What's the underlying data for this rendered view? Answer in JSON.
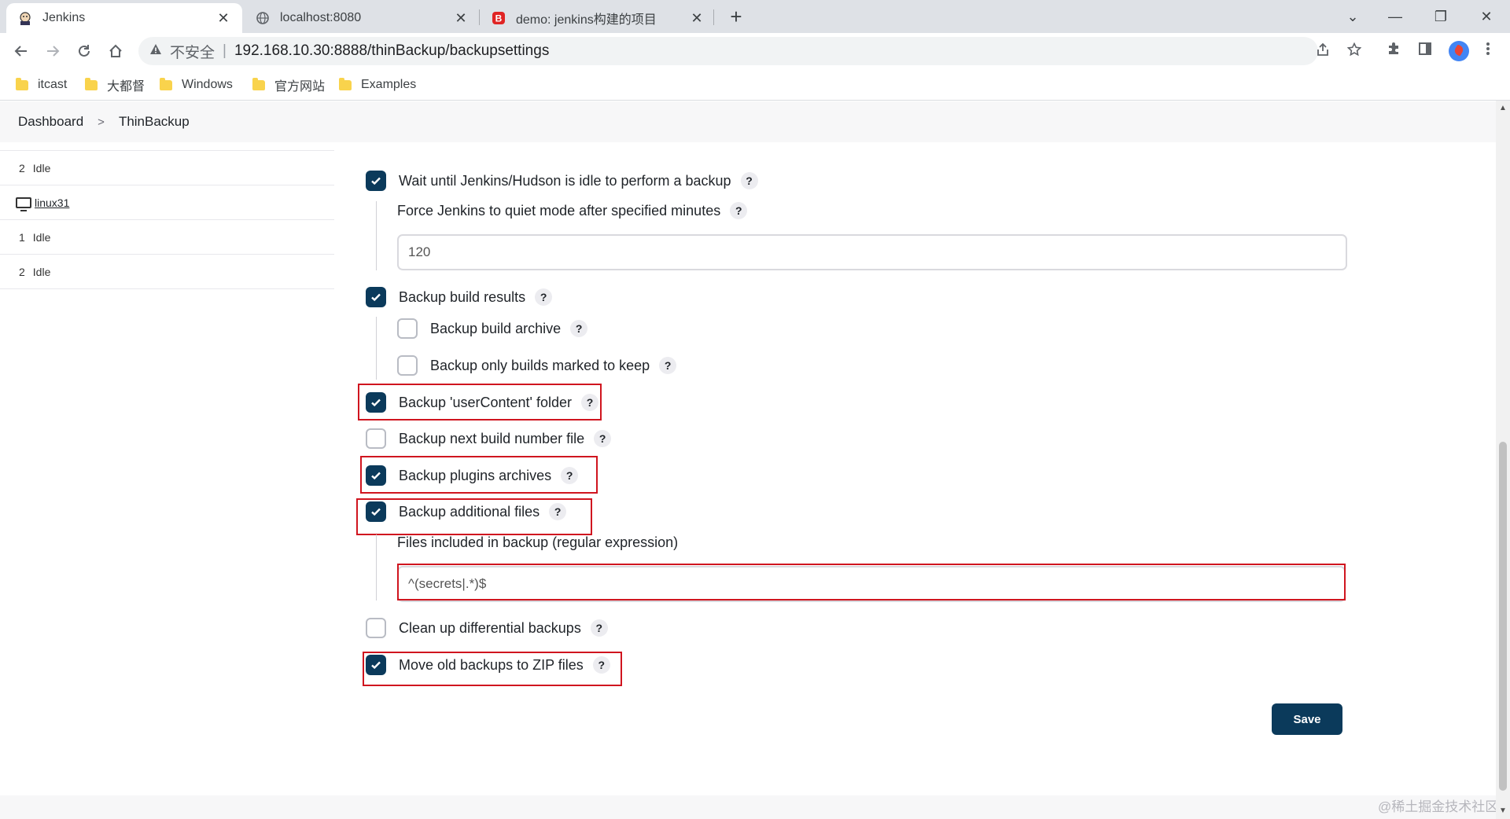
{
  "browser": {
    "tabs": [
      {
        "title": "Jenkins",
        "active": true
      },
      {
        "title": "localhost:8080",
        "active": false
      },
      {
        "title": "demo: jenkins构建的项目",
        "active": false
      }
    ],
    "close_glyph": "✕",
    "new_tab_glyph": "+",
    "window_controls": {
      "chevron": "⌄",
      "minimize": "—",
      "restore": "❐",
      "close": "✕"
    },
    "address": {
      "insecure_label": "不安全",
      "separator": "|",
      "url": "192.168.10.30:8888/thinBackup/backupsettings"
    },
    "bookmarks": [
      "itcast",
      "大都督",
      "Windows",
      "官方网站",
      "Examples"
    ]
  },
  "breadcrumb": {
    "items": [
      "Dashboard",
      "ThinBackup"
    ],
    "separator": ">"
  },
  "sidebar": {
    "rows": [
      {
        "num": "2",
        "status": "Idle"
      },
      {
        "node": "linux31"
      },
      {
        "num": "1",
        "status": "Idle"
      },
      {
        "num": "2",
        "status": "Idle"
      }
    ]
  },
  "form": {
    "help_glyph": "?",
    "wait_idle": {
      "label": "Wait until Jenkins/Hudson is idle to perform a backup",
      "checked": true
    },
    "quiet_mode": {
      "label": "Force Jenkins to quiet mode after specified minutes",
      "value": "120"
    },
    "build_results": {
      "label": "Backup build results",
      "checked": true
    },
    "build_archive": {
      "label": "Backup build archive",
      "checked": false
    },
    "builds_keep": {
      "label": "Backup only builds marked to keep",
      "checked": false
    },
    "user_content": {
      "label": "Backup 'userContent' folder",
      "checked": true
    },
    "next_build": {
      "label": "Backup next build number file",
      "checked": false
    },
    "plugins": {
      "label": "Backup plugins archives",
      "checked": true
    },
    "additional": {
      "label": "Backup additional files",
      "checked": true
    },
    "files_included": {
      "label": "Files included in backup (regular expression)",
      "value": "^(secrets|.*)$"
    },
    "cleanup": {
      "label": "Clean up differential backups",
      "checked": false
    },
    "zip": {
      "label": "Move old backups to ZIP files",
      "checked": true
    },
    "save_label": "Save"
  },
  "watermark": "@稀土掘金技术社区",
  "colors": {
    "accent": "#0b3a5b",
    "highlight_box": "#d0151f"
  }
}
